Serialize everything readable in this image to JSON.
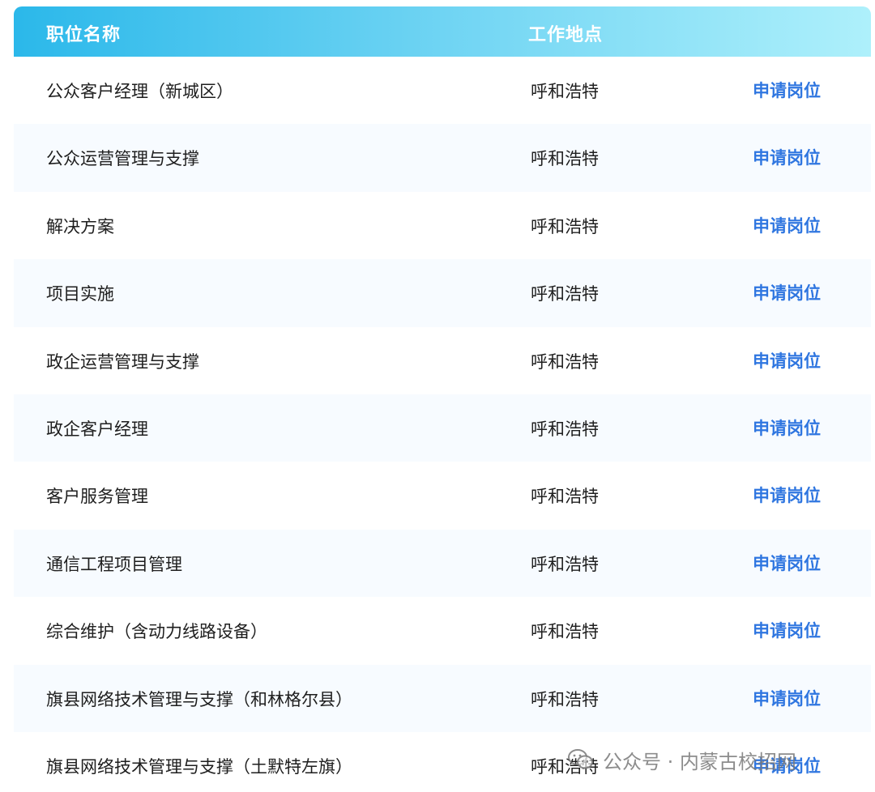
{
  "header": {
    "position_name": "职位名称",
    "work_location": "工作地点"
  },
  "rows": [
    {
      "name": "公众客户经理（新城区）",
      "location": "呼和浩特",
      "action": "申请岗位"
    },
    {
      "name": "公众运营管理与支撑",
      "location": "呼和浩特",
      "action": "申请岗位"
    },
    {
      "name": "解决方案",
      "location": "呼和浩特",
      "action": "申请岗位"
    },
    {
      "name": "项目实施",
      "location": "呼和浩特",
      "action": "申请岗位"
    },
    {
      "name": "政企运营管理与支撑",
      "location": "呼和浩特",
      "action": "申请岗位"
    },
    {
      "name": "政企客户经理",
      "location": "呼和浩特",
      "action": "申请岗位"
    },
    {
      "name": "客户服务管理",
      "location": "呼和浩特",
      "action": "申请岗位"
    },
    {
      "name": "通信工程项目管理",
      "location": "呼和浩特",
      "action": "申请岗位"
    },
    {
      "name": "综合维护（含动力线路设备）",
      "location": "呼和浩特",
      "action": "申请岗位"
    },
    {
      "name": "旗县网络技术管理与支撑（和林格尔县）",
      "location": "呼和浩特",
      "action": "申请岗位"
    },
    {
      "name": "旗县网络技术管理与支撑（土默特左旗）",
      "location": "呼和浩特",
      "action": "申请岗位"
    }
  ],
  "watermark": {
    "text": "公众号 · 内蒙古校招网",
    "icon": "wechat-icon"
  },
  "colors": {
    "header_start": "#2bb8ea",
    "header_end": "#aef0fb",
    "link": "#2f76e0",
    "row_alt": "#f7fbff"
  }
}
